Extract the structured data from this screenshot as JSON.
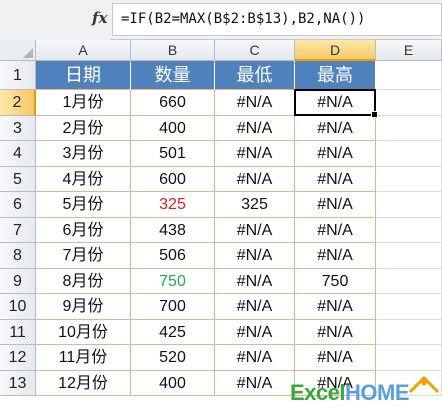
{
  "formula_bar": {
    "fx_label": "fx",
    "formula": "=IF(B2=MAX(B$2:B$13),B2,NA())"
  },
  "columns": [
    "A",
    "B",
    "C",
    "D",
    "E"
  ],
  "selected_column": "D",
  "selected_row": "2",
  "active_cell": "D2",
  "header_row": [
    "日期",
    "数量",
    "最低",
    "最高"
  ],
  "rows": [
    {
      "num": "2",
      "cells": [
        "1月份",
        "660",
        "#N/A",
        "#N/A"
      ]
    },
    {
      "num": "3",
      "cells": [
        "2月份",
        "400",
        "#N/A",
        "#N/A"
      ]
    },
    {
      "num": "4",
      "cells": [
        "3月份",
        "501",
        "#N/A",
        "#N/A"
      ]
    },
    {
      "num": "5",
      "cells": [
        "4月份",
        "600",
        "#N/A",
        "#N/A"
      ]
    },
    {
      "num": "6",
      "cells": [
        "5月份",
        "325",
        "325",
        "#N/A"
      ]
    },
    {
      "num": "7",
      "cells": [
        "6月份",
        "438",
        "#N/A",
        "#N/A"
      ]
    },
    {
      "num": "8",
      "cells": [
        "7月份",
        "506",
        "#N/A",
        "#N/A"
      ]
    },
    {
      "num": "9",
      "cells": [
        "8月份",
        "750",
        "#N/A",
        "750"
      ]
    },
    {
      "num": "10",
      "cells": [
        "9月份",
        "700",
        "#N/A",
        "#N/A"
      ]
    },
    {
      "num": "11",
      "cells": [
        "10月份",
        "425",
        "#N/A",
        "#N/A"
      ]
    },
    {
      "num": "12",
      "cells": [
        "11月份",
        "520",
        "#N/A",
        "#N/A"
      ]
    },
    {
      "num": "13",
      "cells": [
        "12月份",
        "400",
        "#N/A",
        "#N/A"
      ]
    }
  ],
  "header_row_num": "1",
  "highlights": {
    "min_value_color": "#e02020",
    "max_value_color": "#2aa94a",
    "header_fill": "#4f81bd",
    "grid_border": "#e9b38a",
    "selection_fill": "#f7c86a"
  },
  "logo": {
    "part1": "Excel",
    "part2": "HOME"
  }
}
